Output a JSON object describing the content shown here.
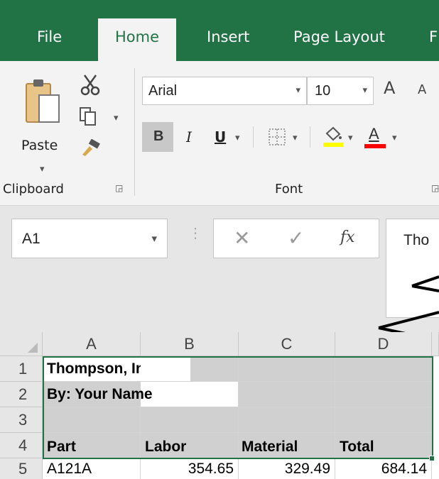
{
  "tabs": [
    "File",
    "Home",
    "Insert",
    "Page Layout",
    "F"
  ],
  "clipboard": {
    "paste_label": "Paste",
    "group_label": "Clipboard"
  },
  "font": {
    "name": "Arial",
    "size": "10",
    "group_label": "Font",
    "bold": "B",
    "italic": "I",
    "underline": "U",
    "font_color": "A",
    "grow": "A",
    "shrink": "A"
  },
  "formula_bar": {
    "name_box": "A1",
    "fx": "fx",
    "content": "Tho"
  },
  "columns": [
    "A",
    "B",
    "C",
    "D"
  ],
  "rows": [
    "1",
    "2",
    "3",
    "4",
    "5"
  ],
  "cells": {
    "a1": "Thompson, Inc",
    "a2": "By:  Your Name",
    "a4": "Part",
    "b4": "Labor",
    "c4": "Material",
    "d4": "Total",
    "a5": "A121A",
    "b5": "354.65",
    "c5": "329.49",
    "d5": "684.14"
  },
  "colors": {
    "accent": "#217346",
    "font_color_bar": "#ff0000",
    "highlight_bar": "#ffff00",
    "selection": "#d0d0d0"
  }
}
